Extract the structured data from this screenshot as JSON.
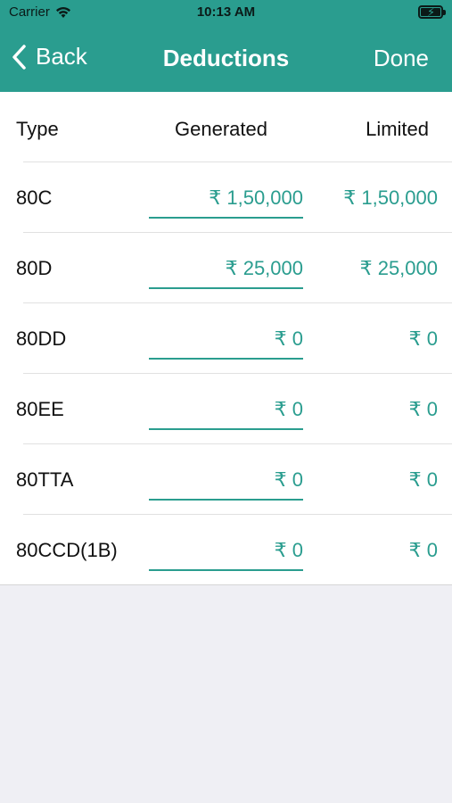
{
  "status_bar": {
    "carrier": "Carrier",
    "time": "10:13 AM",
    "icons": [
      "wifi-icon",
      "battery-charging-icon"
    ]
  },
  "nav": {
    "back_label": "Back",
    "title": "Deductions",
    "done_label": "Done"
  },
  "table": {
    "headers": {
      "type": "Type",
      "generated": "Generated",
      "limited": "Limited"
    },
    "rows": [
      {
        "type": "80C",
        "generated": "₹ 1,50,000",
        "limited": "₹ 1,50,000"
      },
      {
        "type": "80D",
        "generated": "₹ 25,000",
        "limited": "₹ 25,000"
      },
      {
        "type": "80DD",
        "generated": "₹ 0",
        "limited": "₹ 0"
      },
      {
        "type": "80EE",
        "generated": "₹ 0",
        "limited": "₹ 0"
      },
      {
        "type": "80TTA",
        "generated": "₹ 0",
        "limited": "₹ 0"
      },
      {
        "type": "80CCD(1B)",
        "generated": "₹ 0",
        "limited": "₹ 0"
      }
    ]
  },
  "colors": {
    "accent": "#2a9d8f",
    "background": "#efeff4",
    "text": "#111111"
  }
}
